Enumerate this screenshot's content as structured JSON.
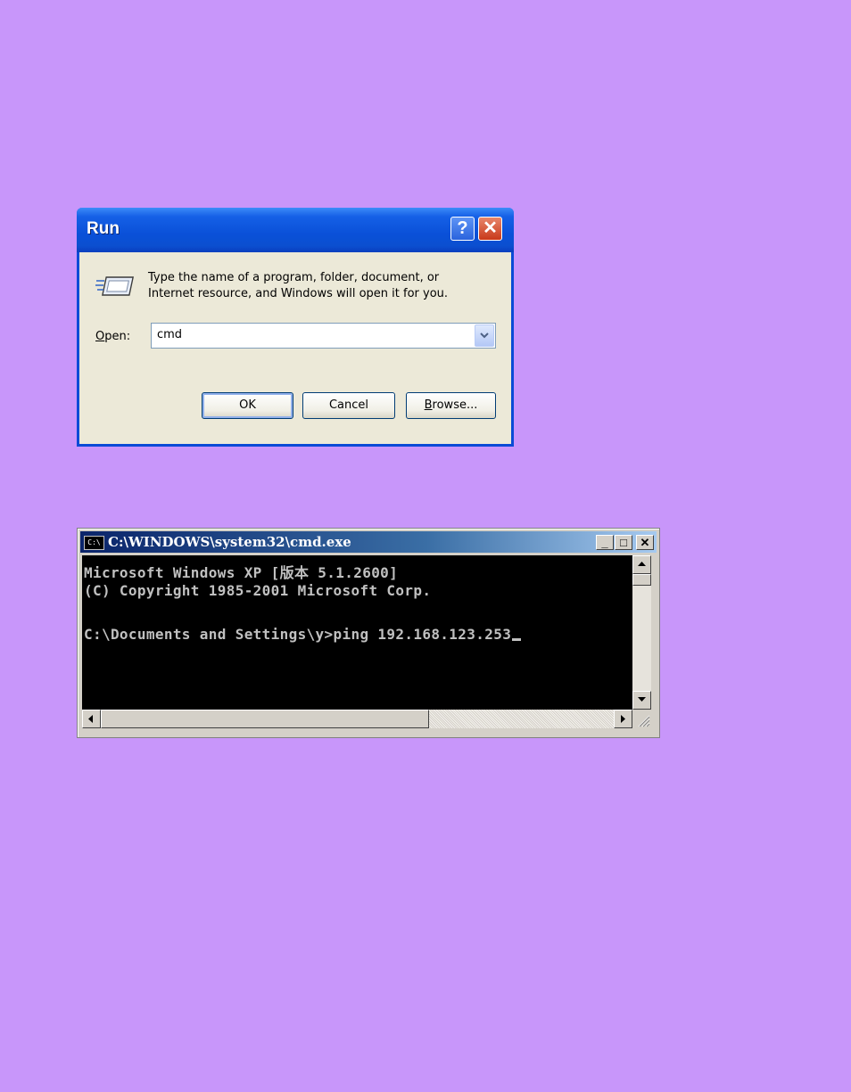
{
  "run_dialog": {
    "title": "Run",
    "help_glyph": "?",
    "close_glyph": "✕",
    "icon": "run-program-icon",
    "description_line1": "Type the name of a program, folder, document, or",
    "description_line2": "Internet resource, and Windows will open it for you.",
    "open_label_accel": "O",
    "open_label_rest": "pen:",
    "open_value": "cmd",
    "ok_label": "OK",
    "cancel_label": "Cancel",
    "browse_label_accel": "B",
    "browse_label_rest": "rowse...",
    "accent_color": "#0a4bd6"
  },
  "cmd_window": {
    "title": "C:\\WINDOWS\\system32\\cmd.exe",
    "icon_text": "C:\\",
    "minimize_glyph": "_",
    "maximize_glyph": "□",
    "close_glyph": "✕",
    "lines": [
      "Microsoft Windows XP [版本 5.1.2600]",
      "(C) Copyright 1985-2001 Microsoft Corp.",
      "",
      "C:\\Documents and Settings\\y>ping 192.168.123.253"
    ],
    "background_color": "#000000",
    "text_color": "#c0c0c0"
  },
  "page": {
    "background_color": "#c896fa"
  }
}
